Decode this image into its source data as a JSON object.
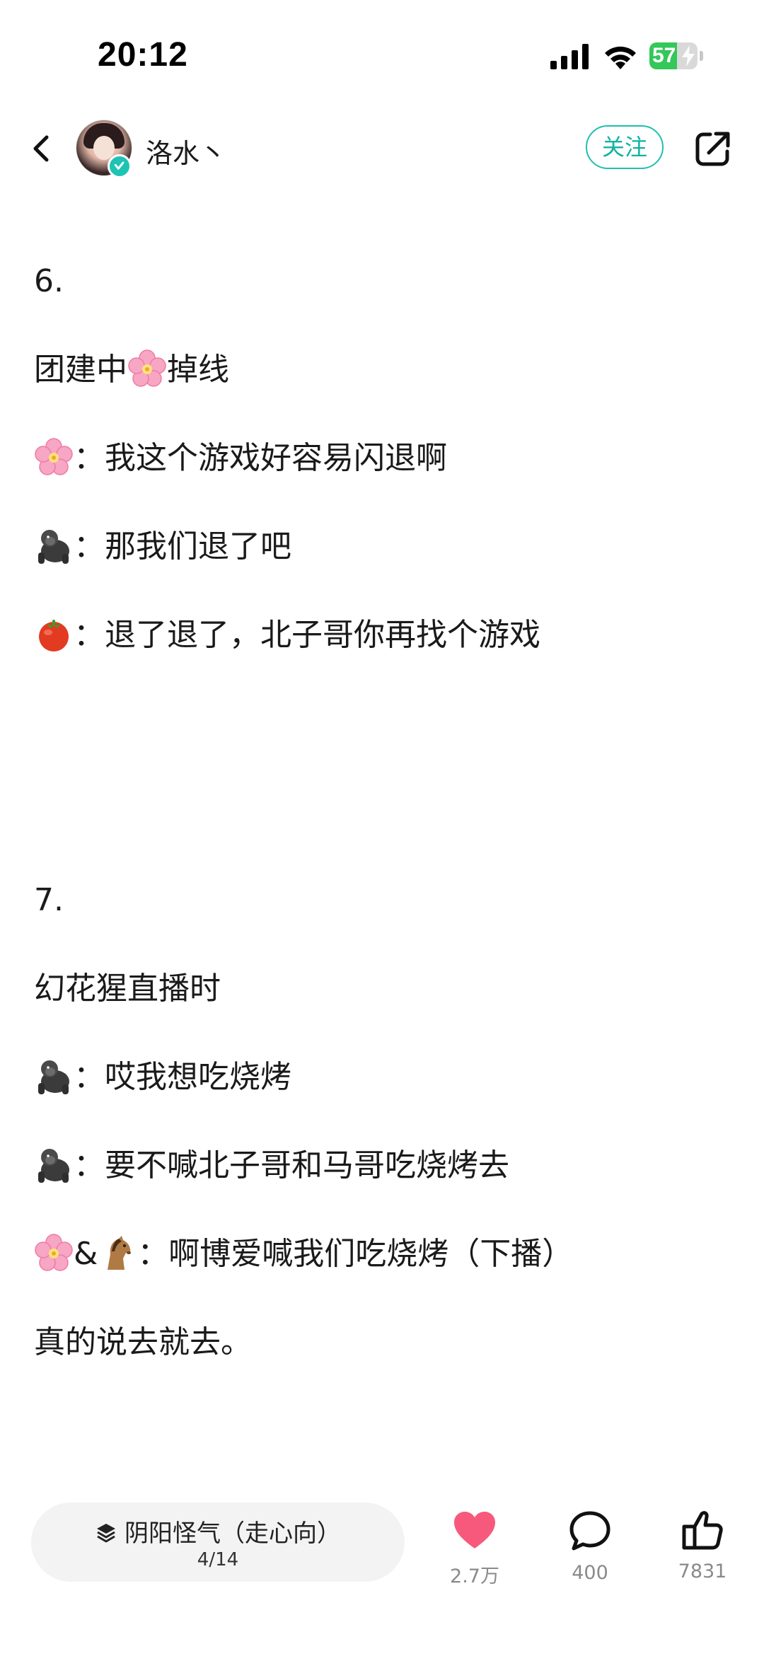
{
  "status_bar": {
    "time": "20:12",
    "battery_level": "57",
    "battery_fraction": 0.57
  },
  "header": {
    "author_name": "洛水丶",
    "follow_label": "关注"
  },
  "post": {
    "lines": [
      {
        "text": "6."
      },
      {
        "text": "团建中",
        "emoji": "cherry-blossom",
        "after": "掉线"
      },
      {
        "emoji": "cherry-blossom",
        "text": "：我这个游戏好容易闪退啊"
      },
      {
        "emoji": "gorilla",
        "text": "：那我们退了吧"
      },
      {
        "emoji": "tomato",
        "text": "：退了退了，北子哥你再找个游戏"
      },
      {
        "text": "7."
      },
      {
        "text": "幻花猩直播时"
      },
      {
        "emoji": "gorilla",
        "text": "：哎我想吃烧烤"
      },
      {
        "emoji": "gorilla",
        "text": "：要不喊北子哥和马哥吃烧烤去"
      },
      {
        "emoji": "cherry-blossom",
        "amp": "&",
        "emoji2": "horse",
        "text": "：啊博爱喊我们吃烧烤（下播）"
      },
      {
        "text": "真的说去就去。"
      }
    ]
  },
  "bottom_bar": {
    "collection_title": "阴阳怪气（走心向）",
    "collection_progress": "4/14",
    "like_count": "2.7万",
    "comment_count": "400",
    "thumb_count": "7831"
  },
  "colors": {
    "accent": "#1fbfb0",
    "like": "#f7597d",
    "battery": "#34c759"
  }
}
